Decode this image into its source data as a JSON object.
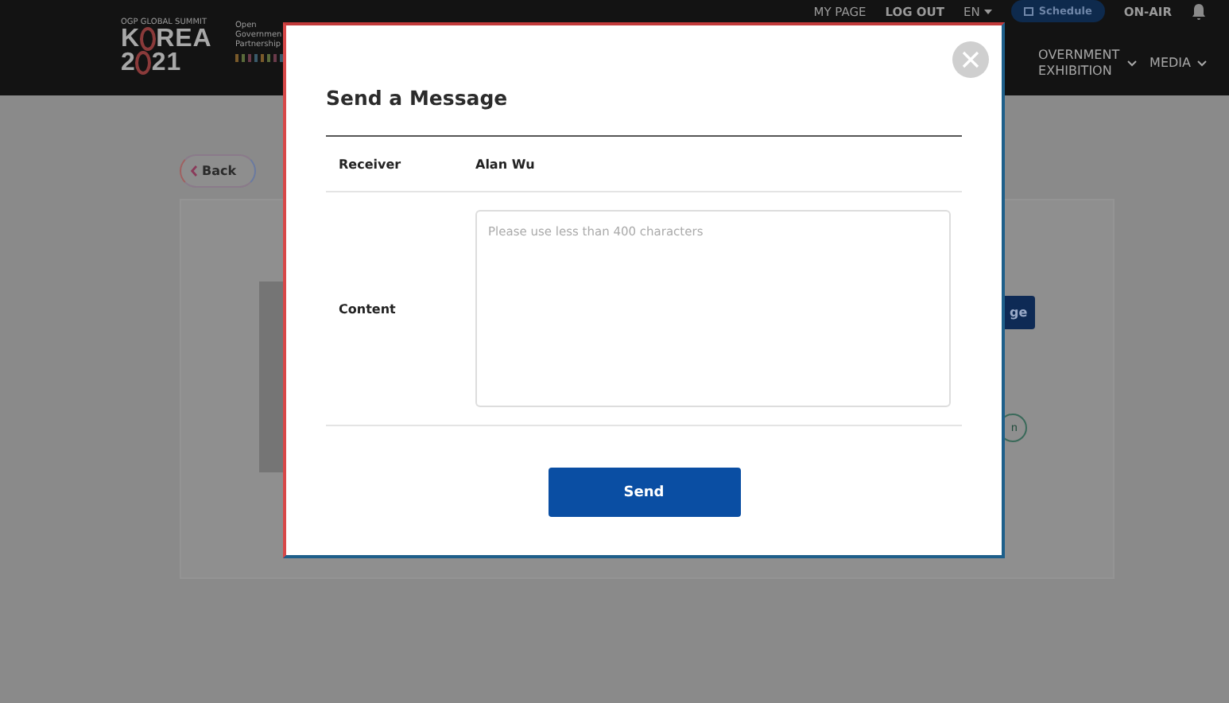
{
  "header": {
    "summit": "OGP GLOBAL SUMMIT",
    "logo": {
      "line1_start": "K",
      "line1_end": "REA",
      "line2_start": "2",
      "line2_end": "21"
    },
    "partner": [
      "Open",
      "Governmen",
      "Partnership"
    ],
    "top_links": [
      {
        "kind": "link",
        "label": "MY PAGE"
      },
      {
        "kind": "link",
        "label": "LOG OUT"
      },
      {
        "kind": "dropdown",
        "label": "EN"
      },
      {
        "kind": "pill",
        "label": "Schedule"
      },
      {
        "kind": "link",
        "label": "ON-AIR"
      }
    ],
    "main_nav": [
      {
        "label": "OVERNMENT EXHIBITION"
      },
      {
        "label": "MEDIA"
      }
    ]
  },
  "page": {
    "back": "Back",
    "message_button": "ge",
    "circle_button": "n"
  },
  "modal": {
    "title": "Send a Message",
    "receiver_label": "Receiver",
    "receiver": "Alan Wu",
    "content_label": "Content",
    "content_placeholder": "Please use less than 400 characters",
    "send": "Send"
  }
}
